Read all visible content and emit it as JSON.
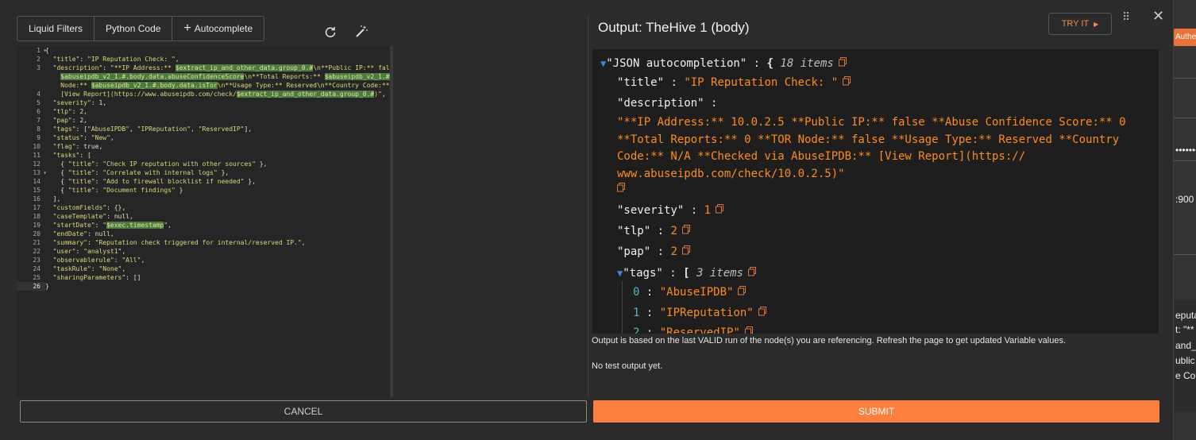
{
  "tabs": [
    {
      "label": "Liquid Filters"
    },
    {
      "label": "Python Code"
    },
    {
      "label": "Autocomplete"
    }
  ],
  "icons": {
    "refresh": "refresh-icon",
    "magic": "magic-wand-icon",
    "drag": "drag-handle-icon",
    "close": "close-icon",
    "copy": "copy-icon"
  },
  "editor": {
    "line_numbers": [
      "1",
      "2",
      "3",
      "",
      "",
      "4",
      "5",
      "6",
      "7",
      "8",
      "9",
      "10",
      "11",
      "12",
      "13",
      "14",
      "15",
      "16",
      "17",
      "18",
      "19",
      "20",
      "21",
      "22",
      "23",
      "24",
      "25",
      "26"
    ]
  },
  "output": {
    "title": "Output: TheHive 1 (body)",
    "try_label": "TRY IT",
    "root_label": "\"JSON autocompletion\"",
    "root_count": "18 items",
    "title_key": "\"title\"",
    "title_val": "\"IP Reputation Check: \"",
    "desc_key": "\"description\"",
    "desc_val": "\"**IP Address:** 10.0.2.5 **Public IP:** false **Abuse Confidence Score:** 0 **Total Reports:** 0 **TOR Node:** false **Usage Type:** Reserved **Country Code:** N/A **Checked via AbuseIPDB:** [View Report](https:// www.abuseipdb.com/check/10.0.2.5)\"",
    "severity_key": "\"severity\"",
    "severity_val": "1",
    "tlp_key": "\"tlp\"",
    "tlp_val": "2",
    "pap_key": "\"pap\"",
    "pap_val": "2",
    "tags_key": "\"tags\"",
    "tags_count": "3 items",
    "tags": [
      {
        "idx": "0",
        "val": "\"AbuseIPDB\""
      },
      {
        "idx": "1",
        "val": "\"IPReputation\""
      },
      {
        "idx": "2",
        "val": "\"ReservedIP\""
      }
    ],
    "note": "Output is based on the last VALID run of the node(s) you are referencing. Refresh the page to get updated Variable values.",
    "no_test": "No test output yet."
  },
  "footer": {
    "cancel_label": "CANCEL",
    "submit_label": "SUBMIT"
  },
  "background_app": {
    "badge": "Authe",
    "masked": "••••••",
    "port": ":900",
    "lines": [
      "eputa",
      "t: \"**",
      "and_o",
      "ublic",
      "e Co"
    ]
  },
  "colors": {
    "accent": "#ff7f3f",
    "string": "#ff8c1a",
    "highlight": "#4e7a3e"
  }
}
